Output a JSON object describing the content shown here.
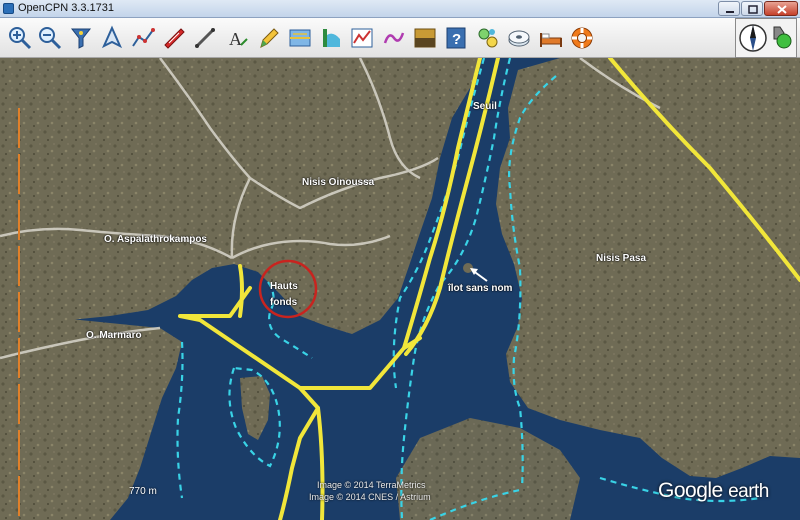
{
  "window": {
    "title": "OpenCPN 3.3.1731",
    "controls": [
      "minimize",
      "maximize",
      "close"
    ]
  },
  "toolbar": {
    "tools": [
      {
        "name": "zoom-in-icon"
      },
      {
        "name": "zoom-out-icon"
      },
      {
        "name": "chart-filter-icon"
      },
      {
        "name": "ownship-icon"
      },
      {
        "name": "route-icon"
      },
      {
        "name": "boat-icon"
      },
      {
        "name": "measure-icon"
      },
      {
        "name": "text-tool-icon"
      },
      {
        "name": "pencil-icon"
      },
      {
        "name": "chart-window-icon"
      },
      {
        "name": "tide-icon"
      },
      {
        "name": "graph-icon"
      },
      {
        "name": "squiggle-icon"
      },
      {
        "name": "layers-icon"
      },
      {
        "name": "help-icon"
      },
      {
        "name": "ais-icon"
      },
      {
        "name": "disk-icon"
      },
      {
        "name": "bed-icon"
      },
      {
        "name": "lifebuoy-icon"
      }
    ]
  },
  "chart": {
    "labels": {
      "seuil": "Seuil",
      "oinoussa": "Nisis Oinoussa",
      "aspalathrokampos": "O. Aspalathrokampos",
      "hauts_line1": "Hauts",
      "hauts_line2": "fonds",
      "ilot": "îlot sans nom",
      "pasa": "Nisis Pasa",
      "marmaro": "O. Marmaro"
    },
    "scale_label": "770 m",
    "attribution_1": "Image © 2014 TerraMetrics",
    "attribution_2": "Image © 2014 CNES / Astrium",
    "watermark_google": "Google",
    "watermark_earth": "earth",
    "colors": {
      "route": "#f1e63a",
      "depth_contour": "#39d3e6",
      "shoal_circle": "#c8241f",
      "sea": "#1d3f6b",
      "land": "#6f6b55"
    }
  }
}
